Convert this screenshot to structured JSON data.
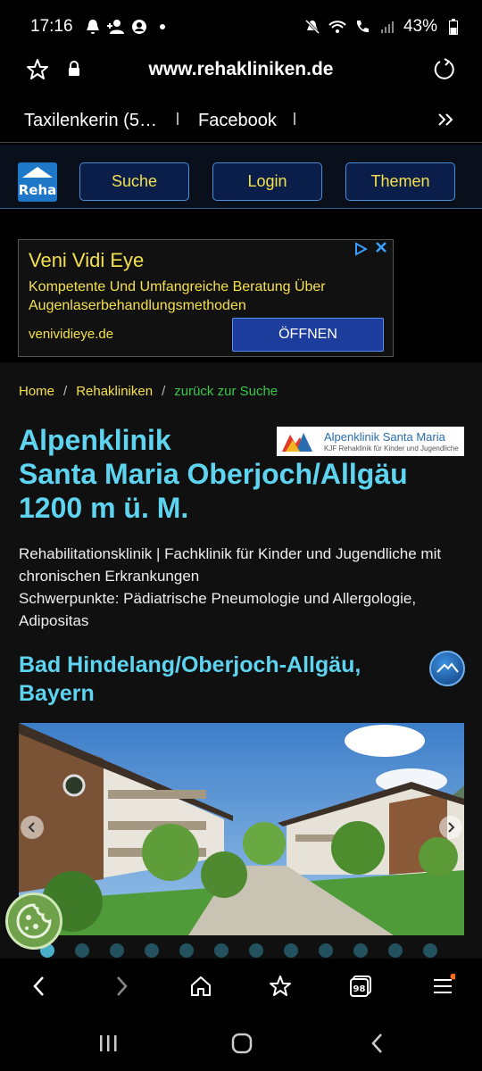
{
  "status_bar": {
    "time": "17:16",
    "battery": "43%",
    "icons": [
      "notification-icon",
      "person-add-icon",
      "account-icon",
      "dot-icon",
      "mute-icon",
      "wifi-icon",
      "call-icon",
      "signal-icon",
      "battery-icon"
    ]
  },
  "browser": {
    "url": "www.rehakliniken.de",
    "bookmarks": [
      "Taxilenkerin (5…",
      "Facebook"
    ],
    "tab_count": "98"
  },
  "site": {
    "logo_text": "Reha",
    "nav": [
      "Suche",
      "Login",
      "Themen"
    ]
  },
  "ad": {
    "title": "Veni Vidi Eye",
    "description": "Kompetente Und Umfangreiche Beratung Über Augenlaserbehandlungsmethoden",
    "domain": "venividieye.de",
    "cta": "ÖFFNEN"
  },
  "breadcrumb": {
    "home": "Home",
    "section": "Rehakliniken",
    "back": "zurück zur Suche",
    "separator": "/"
  },
  "clinic": {
    "logo_name": "Alpenklinik Santa Maria",
    "logo_sub": "KJF Rehaklinik für Kinder und Jugendliche",
    "title": "Alpenklinik Santa Maria Oberjoch/Allgäu 1200 m ü. M.",
    "title_lines": [
      "Alpenklinik",
      "Santa Maria Oberjoch/Allgäu",
      "1200 m ü. M."
    ],
    "description": "Rehabilitationsklinik | Fachklinik für Kinder und Jugendliche mit chronischen Erkrankungen\nSchwerpunkte: Pädiatrische Pneumologie und Allergologie, Adipositas",
    "description_lines": [
      "Rehabilitationsklinik | Fachklinik für Kinder und Jugendliche mit chronischen Erkrankungen",
      "Schwerpunkte: Pädiatrische Pneumologie und Allergologie, Adipositas"
    ],
    "location_lines": [
      "Bad Hindelang/Oberjoch-Allgäu,",
      "Bayern"
    ]
  },
  "carousel": {
    "slide_count": 12,
    "active_index": 0
  },
  "colors": {
    "heading": "#5ed4f0",
    "link": "#f4e04d",
    "back_link": "#37c84a",
    "nav_bg": "#0b1e4a"
  }
}
